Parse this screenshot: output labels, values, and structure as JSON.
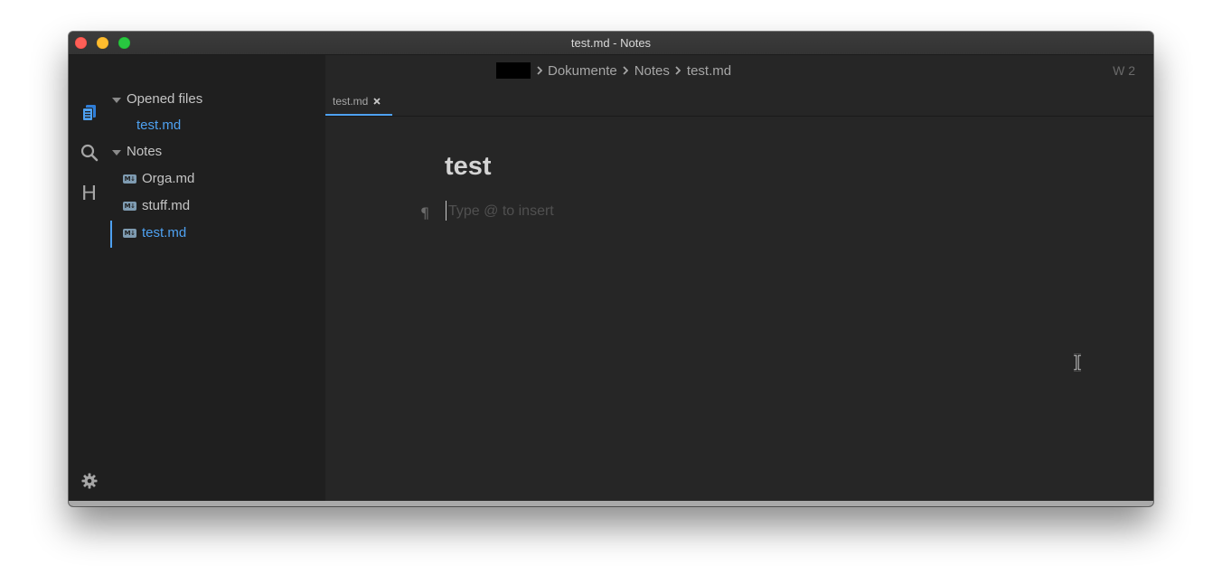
{
  "window": {
    "title": "test.md - Notes"
  },
  "activity_bar": {
    "items": [
      {
        "icon": "files-icon"
      },
      {
        "icon": "search-icon"
      },
      {
        "icon": "heading-icon",
        "label": "H"
      },
      {
        "icon": "gear-icon"
      }
    ]
  },
  "sidebar": {
    "opened_files": {
      "label": "Opened files",
      "items": [
        "test.md"
      ]
    },
    "notes": {
      "label": "Notes",
      "items": [
        {
          "label": "Orga.md",
          "icon": "markdown-icon",
          "icon_text": "M↓"
        },
        {
          "label": "stuff.md",
          "icon": "markdown-icon",
          "icon_text": "M↓"
        },
        {
          "label": "test.md",
          "icon": "markdown-icon",
          "icon_text": "M↓",
          "active": true
        }
      ]
    }
  },
  "breadcrumb": {
    "items": [
      "Dokumente",
      "Notes",
      "test.md"
    ]
  },
  "status": {
    "word_count": "W 2"
  },
  "tabs": [
    {
      "label": "test.md",
      "active": true
    }
  ],
  "document": {
    "title": "test",
    "pilcrow": "¶",
    "placeholder": "Type @ to insert"
  },
  "colors": {
    "accent": "#4ea1f1",
    "background": "#262626",
    "sidebar": "#1f1f1f"
  }
}
